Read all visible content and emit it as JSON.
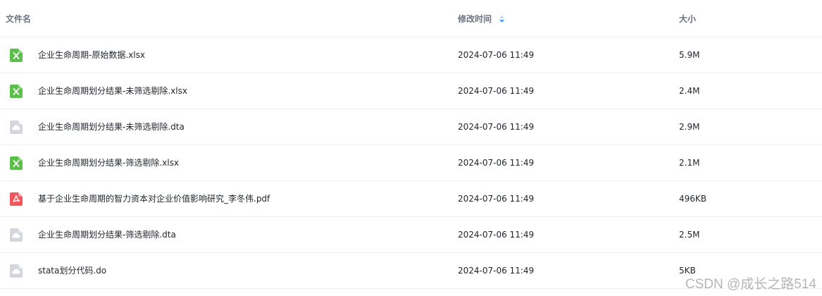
{
  "columns": {
    "name": "文件名",
    "time": "修改时间",
    "size": "大小"
  },
  "sort": {
    "column": "time",
    "icon": "sort-icon",
    "color": "#4a9cf5"
  },
  "colors": {
    "excel": "#5bbf4a",
    "pdf": "#f2555a",
    "generic": "#d3d6dc"
  },
  "files": [
    {
      "name": "企业生命周期-原始数据.xlsx",
      "modified": "2024-07-06 11:49",
      "size": "5.9M",
      "icon": "excel-icon"
    },
    {
      "name": "企业生命周期划分结果-未筛选剔除.xlsx",
      "modified": "2024-07-06 11:49",
      "size": "2.4M",
      "icon": "excel-icon"
    },
    {
      "name": "企业生命周期划分结果-未筛选剔除.dta",
      "modified": "2024-07-06 11:49",
      "size": "2.9M",
      "icon": "cloud-file-icon"
    },
    {
      "name": "企业生命周期划分结果-筛选剔除.xlsx",
      "modified": "2024-07-06 11:49",
      "size": "2.1M",
      "icon": "excel-icon"
    },
    {
      "name": "基于企业生命周期的智力资本对企业价值影响研究_李冬伟.pdf",
      "modified": "2024-07-06 11:49",
      "size": "496KB",
      "icon": "pdf-icon"
    },
    {
      "name": "企业生命周期划分结果-筛选剔除.dta",
      "modified": "2024-07-06 11:49",
      "size": "2.5M",
      "icon": "cloud-file-icon"
    },
    {
      "name": "stata划分代码.do",
      "modified": "2024-07-06 11:49",
      "size": "5KB",
      "icon": "cloud-file-icon"
    }
  ],
  "watermark": "CSDN @成长之路514"
}
